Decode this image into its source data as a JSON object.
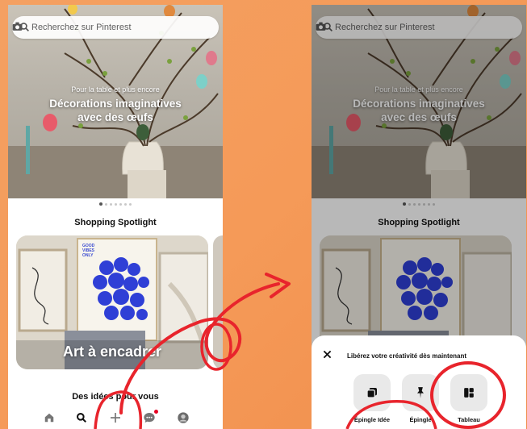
{
  "colors": {
    "background": "#f59a58",
    "annotation_red": "#e8242c",
    "accent_red": "#e60023"
  },
  "left_screen": {
    "search": {
      "placeholder": "Recherchez sur Pinterest",
      "icon": "search-icon",
      "camera_icon": "camera-icon"
    },
    "hero": {
      "subtitle": "Pour la table et plus encore",
      "title_line1": "Décorations imaginatives",
      "title_line2": "avec des œufs"
    },
    "carousel_pages": 7,
    "carousel_active": 1,
    "section_title": "Shopping Spotlight",
    "card": {
      "label": "Art à encadrer",
      "poster_text": "GOOD VIBES ONLY"
    },
    "ideas_title": "Des idées pour vous",
    "tabs": [
      "home-icon",
      "search-icon",
      "plus-icon",
      "chat-icon",
      "profile-icon"
    ]
  },
  "right_screen": {
    "search": {
      "placeholder": "Recherchez sur Pinterest"
    },
    "hero": {
      "subtitle": "Pour la table et plus encore",
      "title_line1": "Décorations imaginatives",
      "title_line2": "avec des œufs"
    },
    "section_title": "Shopping Spotlight",
    "sheet": {
      "title": "Libérez votre créativité dès maintenant",
      "options": [
        {
          "label": "Épingle Idée",
          "icon": "idea-pin-icon"
        },
        {
          "label": "Épingle",
          "icon": "pin-icon"
        },
        {
          "label": "Tableau",
          "icon": "board-icon"
        }
      ]
    }
  }
}
